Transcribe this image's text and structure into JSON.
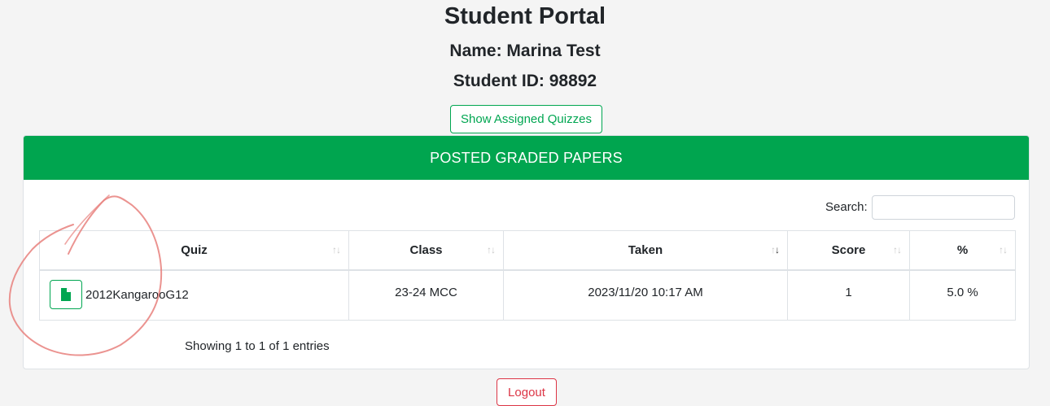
{
  "portal": {
    "title": "Student Portal",
    "name_line": "Name: Marina Test",
    "id_line": "Student ID: 98892"
  },
  "buttons": {
    "show_assigned": "Show Assigned Quizzes",
    "logout": "Logout"
  },
  "card": {
    "header": "POSTED GRADED PAPERS",
    "search_label": "Search:",
    "search_value": ""
  },
  "table": {
    "columns": [
      "Quiz",
      "Class",
      "Taken",
      "Score",
      "%"
    ],
    "rows": [
      {
        "quiz": "2012KangarooG12",
        "class": "23-24 MCC",
        "taken": "2023/11/20 10:17 AM",
        "score": "1",
        "percent": "5.0 %"
      }
    ],
    "sorted_column": "Taken",
    "sort_direction": "descending"
  },
  "footer": {
    "showing": "Showing 1 to 1 of 1 entries"
  },
  "icons": {
    "quiz_file": "file-icon",
    "sort": "sort-arrows-icon"
  },
  "colors": {
    "accent_green": "#00a54f",
    "logout_red": "#dc3545",
    "annotation_red": "#e8807d"
  }
}
